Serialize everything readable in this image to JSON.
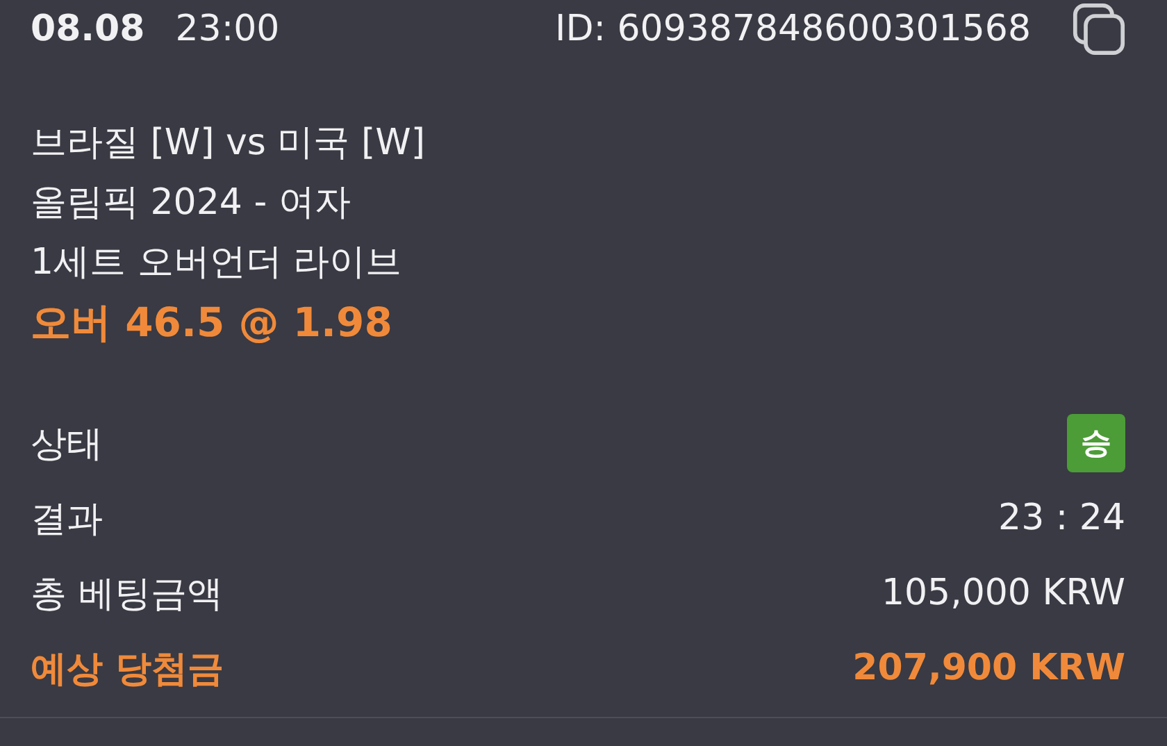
{
  "header": {
    "date": "08.08",
    "time": "23:00",
    "id": "ID: 609387848600301568"
  },
  "bet": {
    "match": "브라질 [W] vs 미국 [W]",
    "league": "올림픽 2024 - 여자",
    "market": "1세트 오버언더 라이브",
    "pick": "오버 46.5 @ 1.98"
  },
  "rows": [
    {
      "kind": "badge",
      "label": "상태",
      "value": "승",
      "color": "#4c9c38",
      "highlight": false
    },
    {
      "kind": "text",
      "label": "결과",
      "value": "23 : 24",
      "highlight": false
    },
    {
      "kind": "text",
      "label": "총 베팅금액",
      "value": "105,000 KRW",
      "highlight": false
    },
    {
      "kind": "text",
      "label": "예상 당첨금",
      "value": "207,900 KRW",
      "highlight": true
    }
  ]
}
